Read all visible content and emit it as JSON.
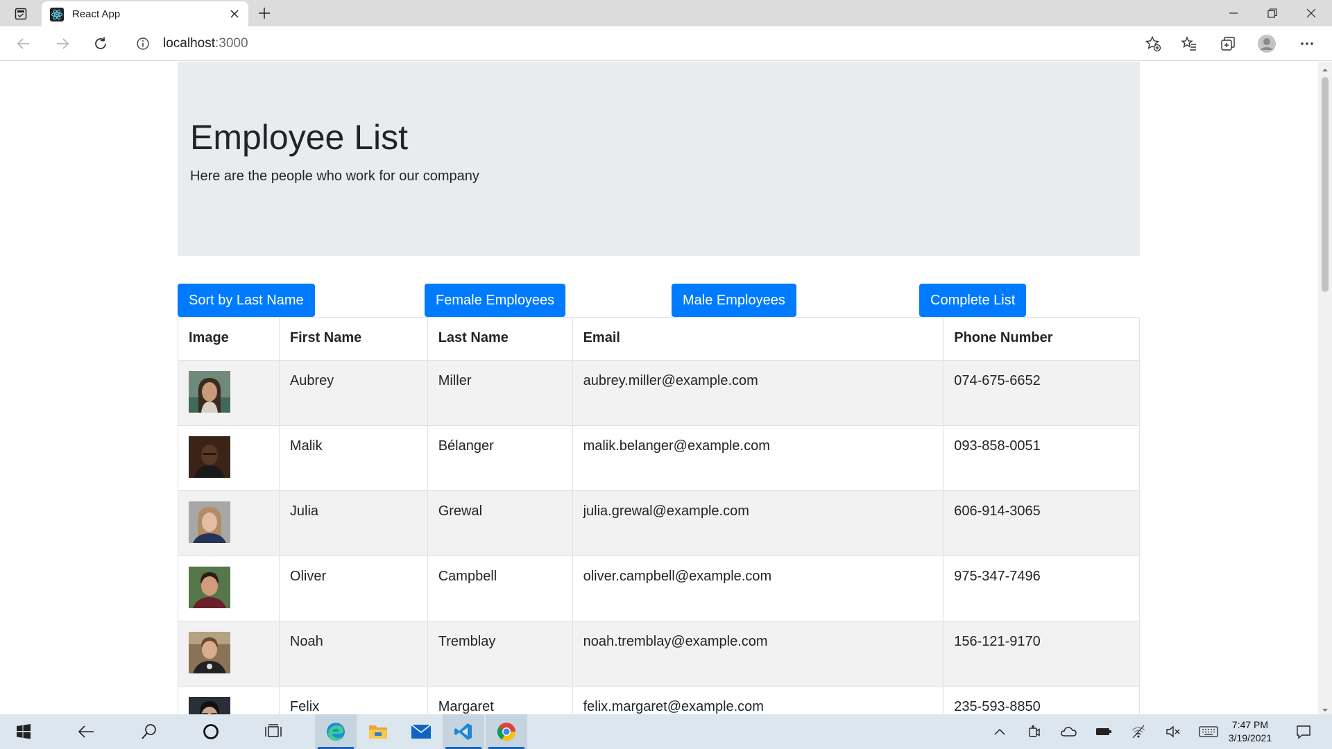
{
  "browser": {
    "tab_title": "React App",
    "address_host": "localhost",
    "address_port": ":3000"
  },
  "page": {
    "title": "Employee List",
    "subtitle": "Here are the people who work for our company",
    "buttons": {
      "sort_last": "Sort by Last Name",
      "female": "Female Employees",
      "male": "Male Employees",
      "complete": "Complete List"
    },
    "table": {
      "headers": [
        "Image",
        "First Name",
        "Last Name",
        "Email",
        "Phone Number"
      ],
      "rows": [
        {
          "first": "Aubrey",
          "last": "Miller",
          "email": "aubrey.miller@example.com",
          "phone": "074-675-6652",
          "photo": "female-portrait"
        },
        {
          "first": "Malik",
          "last": "Bélanger",
          "email": "malik.belanger@example.com",
          "phone": "093-858-0051",
          "photo": "male-portrait"
        },
        {
          "first": "Julia",
          "last": "Grewal",
          "email": "julia.grewal@example.com",
          "phone": "606-914-3065",
          "photo": "female-portrait"
        },
        {
          "first": "Oliver",
          "last": "Campbell",
          "email": "oliver.campbell@example.com",
          "phone": "975-347-7496",
          "photo": "male-portrait"
        },
        {
          "first": "Noah",
          "last": "Tremblay",
          "email": "noah.tremblay@example.com",
          "phone": "156-121-9170",
          "photo": "male-portrait"
        },
        {
          "first": "Felix",
          "last": "Margaret",
          "email": "felix.margaret@example.com",
          "phone": "235-593-8850",
          "photo": "male-portrait"
        }
      ]
    }
  },
  "taskbar": {
    "time": "7:47 PM",
    "date": "3/19/2021"
  },
  "colors": {
    "button_primary": "#007bff",
    "jumbotron_bg": "#e9ecef",
    "row_stripe": "#f2f2f2"
  }
}
